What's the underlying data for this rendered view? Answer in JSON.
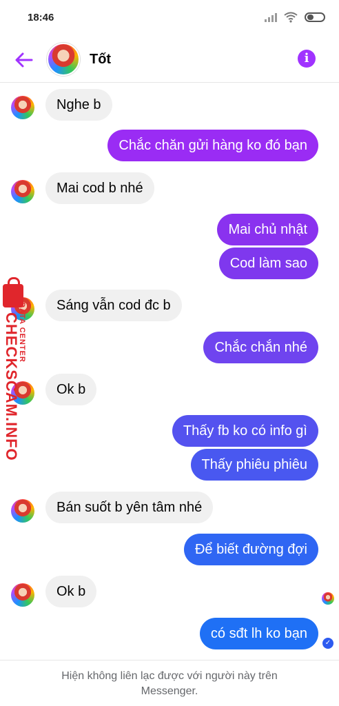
{
  "status_bar": {
    "time": "18:46"
  },
  "header": {
    "contact_name": "Tốt",
    "back_icon": "arrow-left-icon",
    "info_icon": "info-icon",
    "accent_color": "#a033ff"
  },
  "messages": [
    {
      "side": "in",
      "text": "Nghe b"
    },
    {
      "side": "out",
      "text": "Chắc chăn gửi hàng ko đó bạn",
      "color": "#9a2cf4"
    },
    {
      "side": "in",
      "text": "Mai cod b nhé"
    },
    {
      "side": "out",
      "text": "Mai chủ nhật",
      "color": "#8a32ef"
    },
    {
      "side": "out",
      "text": "Cod làm sao",
      "color": "#7f38ee"
    },
    {
      "side": "in",
      "text": "Sáng vẫn cod đc b"
    },
    {
      "side": "out",
      "text": "Chắc chắn nhé",
      "color": "#6f44ef"
    },
    {
      "side": "in",
      "text": "Ok b"
    },
    {
      "side": "out",
      "text": "Thấy fb ko có info gì",
      "color": "#5452ef"
    },
    {
      "side": "out",
      "text": "Thấy phiêu phiêu",
      "color": "#4958f0"
    },
    {
      "side": "in",
      "text": "Bán suốt b yên tâm nhé"
    },
    {
      "side": "out",
      "text": "Để biết đường đợi",
      "color": "#2f66f3"
    },
    {
      "side": "in",
      "text": "Ok b"
    },
    {
      "side": "out",
      "text": "có sđt lh ko bạn",
      "color": "#1f70f5"
    }
  ],
  "watermark": {
    "main": "CHECKSCAM.INFO",
    "sub": "DATA CENTER"
  },
  "footer": {
    "notice": "Hiện không liên lạc được với người này trên Messenger."
  }
}
